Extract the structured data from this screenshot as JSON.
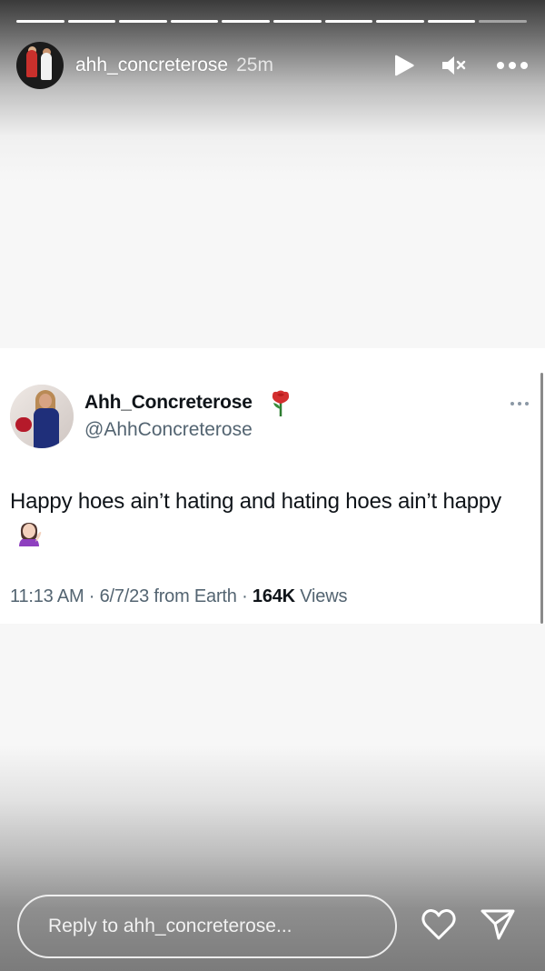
{
  "story": {
    "progress_segments": [
      1,
      1,
      1,
      1,
      1,
      1,
      1,
      1,
      1,
      0
    ],
    "username": "ahh_concreterose",
    "time": "25m",
    "icons": {
      "play": "play-icon",
      "mute": "mute-icon",
      "more": "more-options-icon"
    }
  },
  "tweet": {
    "display_name": "Ahh_Concreterose",
    "handle": "@AhhConcreterose",
    "text": "Happy hoes ain’t hating and hating hoes ain’t happy",
    "meta_prefix": "11:13 AM · 6/7/23 from Earth · ",
    "views_count": "164K",
    "views_label": " Views"
  },
  "reply": {
    "placeholder": "Reply to ahh_concreterose..."
  }
}
